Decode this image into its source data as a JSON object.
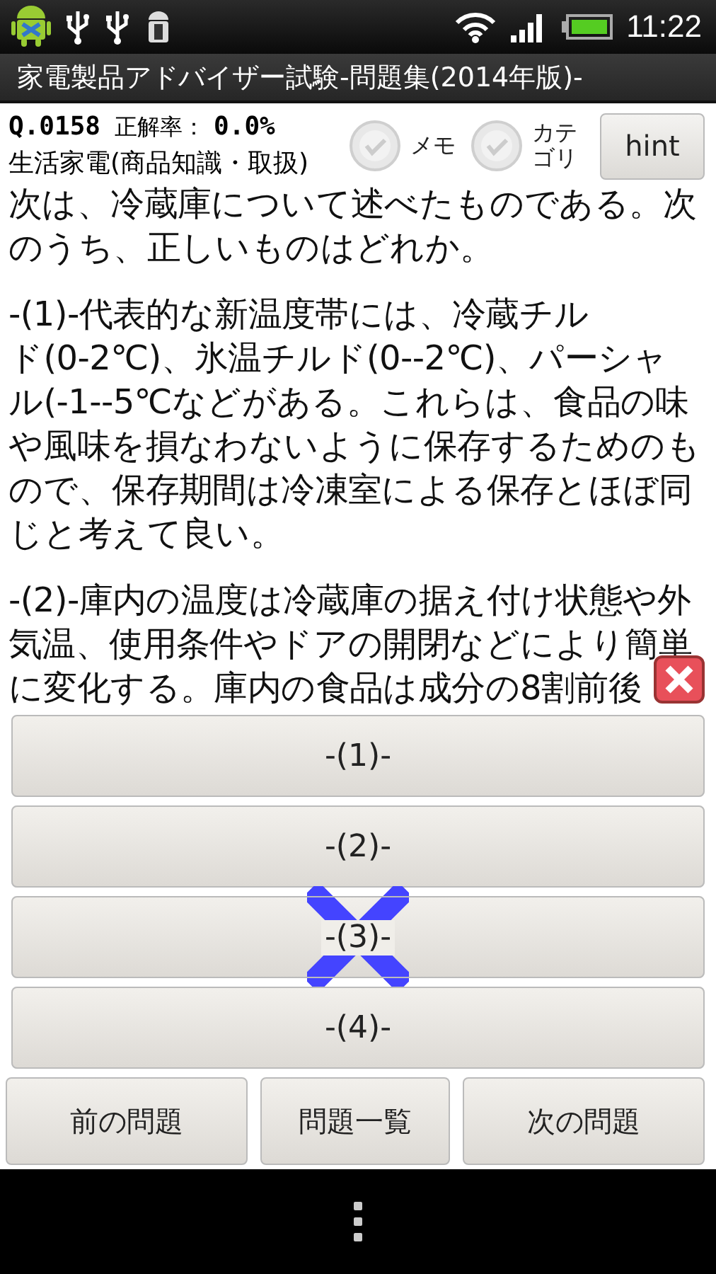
{
  "status_bar": {
    "time": "11:22"
  },
  "window": {
    "title": "家電製品アドバイザー試験-問題集(2014年版)-"
  },
  "header": {
    "question_number": "Q.0158",
    "rate_label": "正解率：",
    "rate_value": "0.0%",
    "category": "生活家電(商品知識・取扱)",
    "toggles": [
      {
        "label": "メモ",
        "checked": false
      },
      {
        "label": "カテゴリ",
        "checked": false
      }
    ],
    "hint_button": "hint"
  },
  "question": {
    "paragraphs": [
      {
        "lines": [
          "次は、冷蔵庫について述べたものである。次",
          "のうち、正しいものはどれか。"
        ]
      },
      {
        "lines": [
          "-(1)-代表的な新温度帯には、冷蔵チル",
          "ド(0-2℃)、氷温チルド(0--2℃)、パーシャ",
          "ル(-1--5℃などがある。これらは、食品の味",
          "や風味を損なわないように保存するためのも",
          "ので、保存期間は冷凍室による保存とほぼ同",
          "じと考えて良い。"
        ]
      },
      {
        "lines": [
          "-(2)-庫内の温度は冷蔵庫の据え付け状態や外",
          "気温、使用条件やドアの開閉などにより簡単",
          "に変化する。庫内の食品は成分の8割前後"
        ]
      }
    ]
  },
  "answers": [
    {
      "label": "-(1)-",
      "marked_wrong": false
    },
    {
      "label": "-(2)-",
      "marked_wrong": false
    },
    {
      "label": "-(3)-",
      "marked_wrong": true
    },
    {
      "label": "-(4)-",
      "marked_wrong": false
    }
  ],
  "nav_buttons": [
    "前の問題",
    "問題一覧",
    "次の問題"
  ]
}
